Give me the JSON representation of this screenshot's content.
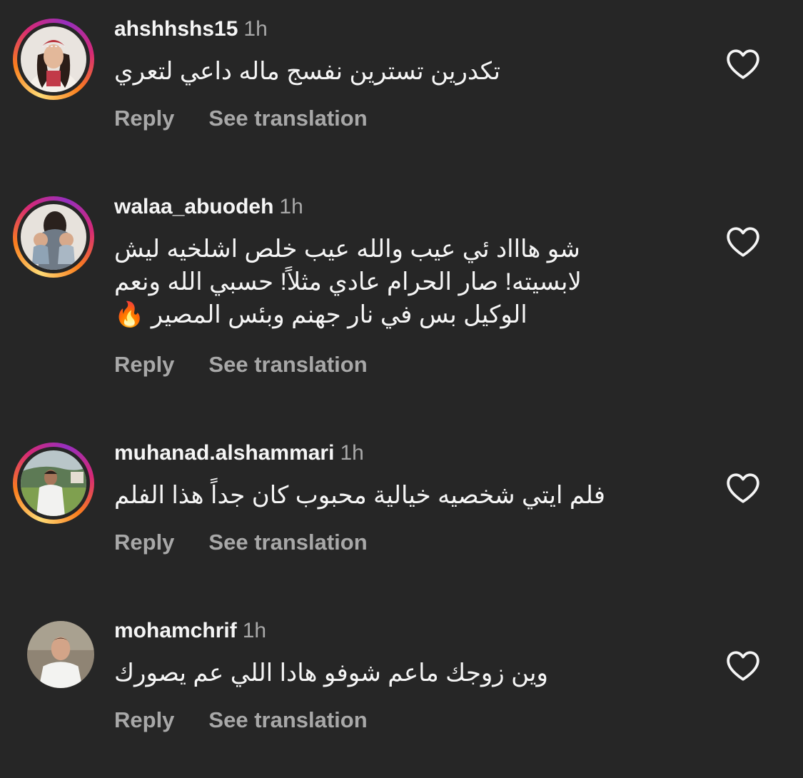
{
  "comments": [
    {
      "username": "ahshhshs15",
      "time": "1h",
      "text": "تكدرين تسترين نفسج ماله داعي لتعري",
      "reply_label": "Reply",
      "translate_label": "See translation",
      "story_ring": true
    },
    {
      "username": "walaa_abuodeh",
      "time": "1h",
      "text": "شو هاااد ئي عيب والله عيب خلص اشلخيه ليش لابسيته!  صار الحرام عادي مثلاً! حسبي الله ونعم الوكيل بس في نار جهنم وبئس المصير 🔥",
      "reply_label": "Reply",
      "translate_label": "See translation",
      "story_ring": true
    },
    {
      "username": "muhanad.alshammari",
      "time": "1h",
      "text": "فلم ايتي شخصيه خيالية محبوب كان جداً هذا الفلم",
      "reply_label": "Reply",
      "translate_label": "See translation",
      "story_ring": true
    },
    {
      "username": "mohamchrif",
      "time": "1h",
      "text": "وين زوجك ماعم شوفو هادا اللي عم يصورك",
      "reply_label": "Reply",
      "translate_label": "See translation",
      "story_ring": false
    }
  ],
  "icons": {
    "like": "heart-outline-icon",
    "story_ring_colors": [
      "#feda75",
      "#fa7e1e",
      "#d62976",
      "#962fbf"
    ]
  },
  "colors": {
    "background": "#262626",
    "primary_text": "#f5f5f5",
    "secondary_text": "#a8a8a8"
  }
}
